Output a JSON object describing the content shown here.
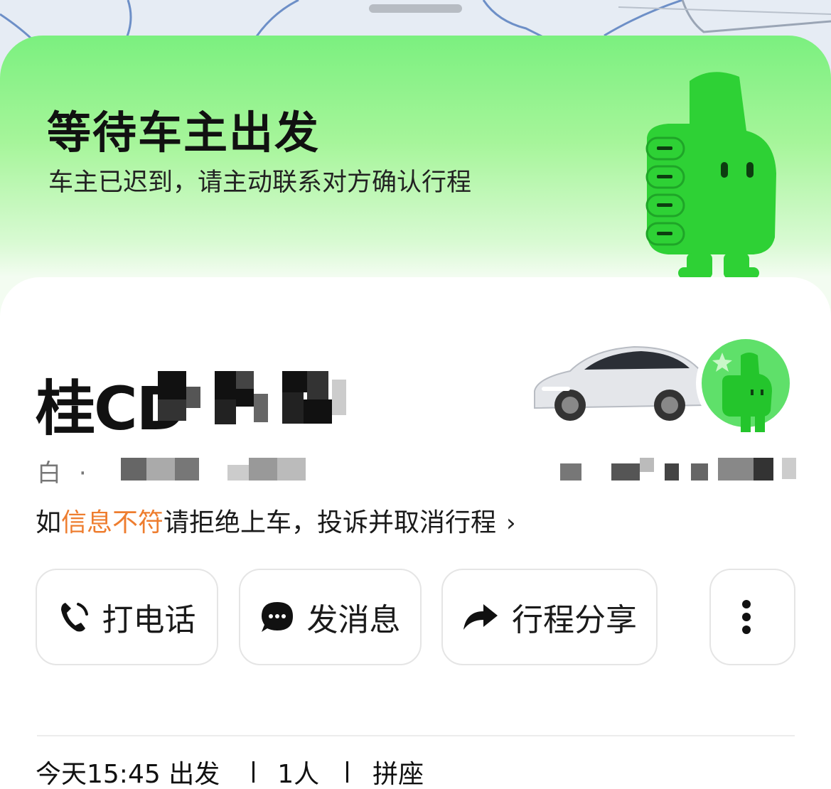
{
  "status": {
    "title": "等待车主出发",
    "subtitle": "车主已迟到，请主动联系对方确认行程"
  },
  "vehicle": {
    "plate_visible": "桂CD",
    "color": "白",
    "separator": "·"
  },
  "warning": {
    "prefix": "如",
    "highlight": "信息不符",
    "suffix": "请拒绝上车，投诉并取消行程",
    "chevron": "›"
  },
  "actions": {
    "call": "打电话",
    "message": "发消息",
    "share": "行程分享",
    "more_icon": "more-vertical-icon"
  },
  "trip": {
    "time": "今天15:45 出发",
    "passengers": "1人",
    "type": "拼座"
  },
  "colors": {
    "brand_green": "#2ed135",
    "header_green": "#7bf07f",
    "highlight_orange": "#ee7d2f",
    "text_dark": "#111111"
  }
}
